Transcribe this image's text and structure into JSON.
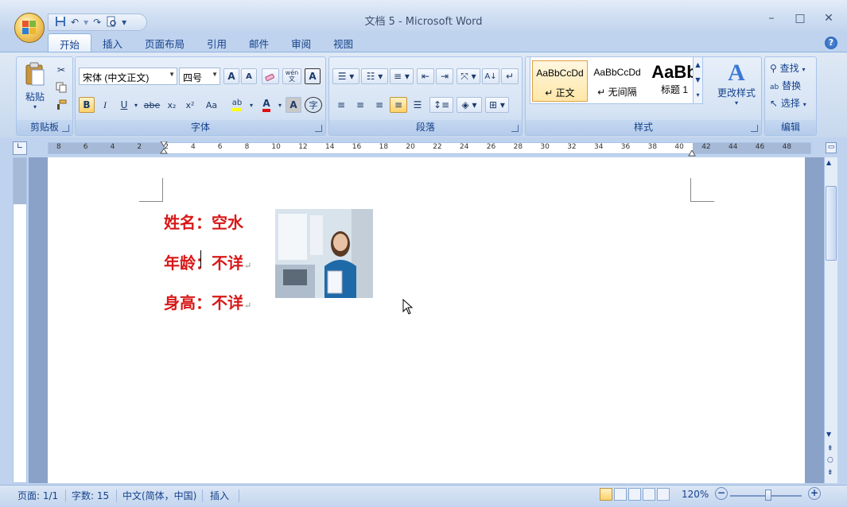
{
  "window": {
    "title": "文档 5 - Microsoft Word",
    "minimize": "–",
    "maximize": "□",
    "close": "✕"
  },
  "quick_access": {
    "save_icon": "floppy-icon",
    "undo_icon": "undo-icon",
    "redo_icon": "redo-icon",
    "print_preview_icon": "print-preview-icon",
    "customize": "▾"
  },
  "tabs": [
    {
      "label": "开始",
      "active": true
    },
    {
      "label": "插入"
    },
    {
      "label": "页面布局"
    },
    {
      "label": "引用"
    },
    {
      "label": "邮件"
    },
    {
      "label": "审阅"
    },
    {
      "label": "视图"
    }
  ],
  "ribbon": {
    "clipboard": {
      "label": "剪贴板",
      "paste": "粘贴"
    },
    "font": {
      "label": "字体",
      "font_name": "宋体 (中文正文)",
      "font_size": "四号",
      "bold": "B",
      "italic": "I",
      "underline": "U",
      "strike": "abe",
      "subscript": "x₂",
      "superscript": "x²",
      "change_case": "Aa",
      "grow": "A",
      "shrink": "A",
      "char_border": "A",
      "char_shade": "A",
      "enclose": "字",
      "wen": "wén 文",
      "highlight_color": "#ffff00",
      "font_color": "#e01010"
    },
    "paragraph": {
      "label": "段落"
    },
    "styles": {
      "label": "样式",
      "items": [
        {
          "sample": "AaBbCcDd",
          "name": "↵ 正文"
        },
        {
          "sample": "AaBbCcDd",
          "name": "↵ 无间隔"
        },
        {
          "sample": "AaBb",
          "name": "标题 1"
        }
      ],
      "change_styles": "更改样式"
    },
    "editing": {
      "label": "编辑",
      "find": "查找",
      "replace": "替换",
      "select": "选择"
    }
  },
  "ruler": {
    "numbers": [
      "8",
      "6",
      "4",
      "2",
      "2",
      "4",
      "6",
      "8",
      "10",
      "12",
      "14",
      "16",
      "18",
      "20",
      "22",
      "24",
      "26",
      "28",
      "30",
      "32",
      "34",
      "36",
      "38",
      "40",
      "42",
      "44",
      "46",
      "48"
    ]
  },
  "document": {
    "lines": [
      {
        "label": "姓名：",
        "value": "空水"
      },
      {
        "label": "年龄：",
        "value": "不详"
      },
      {
        "label": "身高：",
        "value": "不详"
      }
    ],
    "para_mark": "↵",
    "text_color": "#d81818"
  },
  "status": {
    "page": "页面: 1/1",
    "words": "字数: 15",
    "language": "中文(简体，中国)",
    "mode": "插入",
    "zoom": "120%",
    "zoom_out": "−",
    "zoom_in": "+"
  }
}
